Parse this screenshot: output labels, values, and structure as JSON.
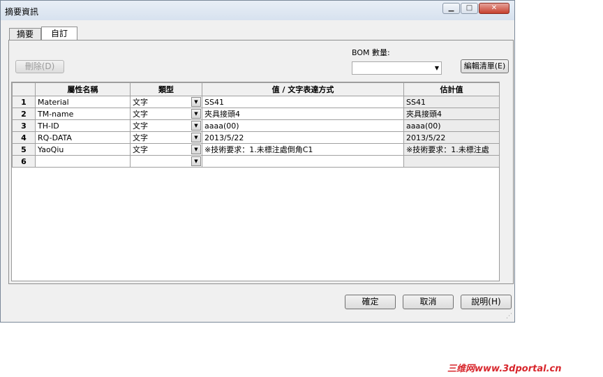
{
  "window": {
    "title": "摘要資訊",
    "min_glyph": "▁",
    "max_glyph": "□",
    "close_glyph": "✕"
  },
  "tabs": [
    {
      "label": "摘要",
      "active": false
    },
    {
      "label": "自訂",
      "active": true
    }
  ],
  "toolbar": {
    "delete_label": "刪除(D)",
    "bom_label": "BOM 數量:",
    "bom_value": "",
    "edit_list_label": "編輯清單(E)"
  },
  "grid": {
    "columns": [
      "屬性名稱",
      "類型",
      "值 / 文字表達方式",
      "估計值"
    ],
    "rows": [
      {
        "num": "1",
        "name": "Material",
        "type": "文字",
        "value": "SS41",
        "estimate": "SS41"
      },
      {
        "num": "2",
        "name": "TM-name",
        "type": "文字",
        "value": "夾具接頭4",
        "estimate": "夾具接頭4"
      },
      {
        "num": "3",
        "name": "TH-ID",
        "type": "文字",
        "value": "aaaa(00)",
        "estimate": "aaaa(00)"
      },
      {
        "num": "4",
        "name": "RQ-DATA",
        "type": "文字",
        "value": "2013/5/22",
        "estimate": "2013/5/22"
      },
      {
        "num": "5",
        "name": "YaoQiu",
        "type": "文字",
        "value": "※技術要求：1.未標注處倒角C1",
        "estimate": "※技術要求：1.未標注處"
      },
      {
        "num": "6",
        "name": "",
        "type": "",
        "value": "",
        "estimate": ""
      }
    ]
  },
  "footer": {
    "ok_label": "確定",
    "cancel_label": "取消",
    "help_label": "說明(H)"
  },
  "watermark": {
    "text": "三维网www.3dportal.cn",
    "color": "#d8262c"
  },
  "colors": {
    "titlebar": "#dbe5f1",
    "close_button": "#c6402f",
    "dialog_bg": "#f0f0f0"
  }
}
